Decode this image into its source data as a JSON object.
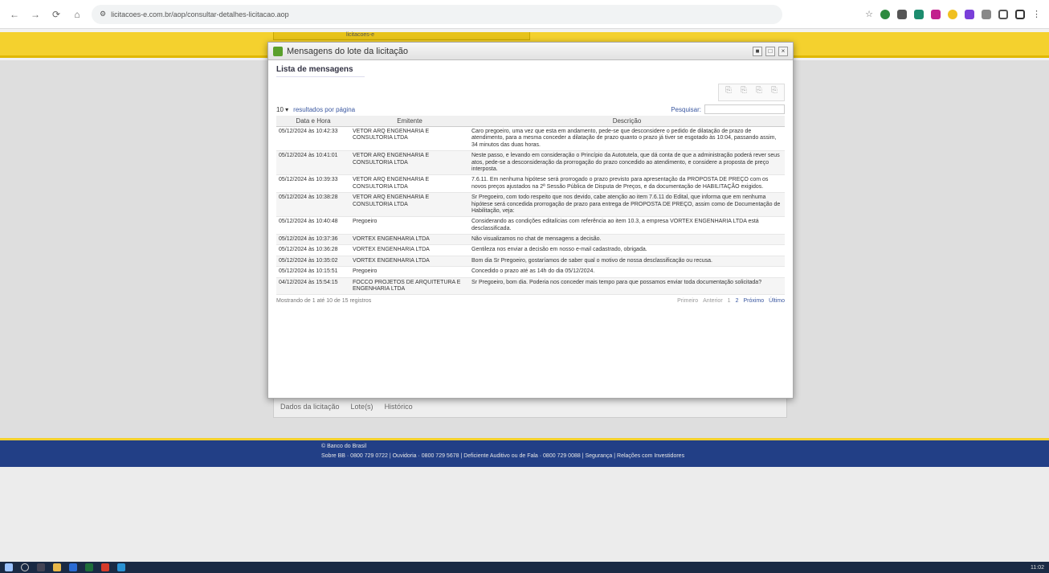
{
  "browser": {
    "url": "licitacoes-e.com.br/aop/consultar-detalhes-licitacao.aop",
    "back": "←",
    "forward": "→",
    "reload": "⟳",
    "home": "⌂"
  },
  "site": {
    "top_tab": "licitacoes-e",
    "behind_tabs": [
      "Dados da licitação",
      "Lote(s)",
      "Histórico"
    ]
  },
  "modal": {
    "title": "Mensagens do lote da licitação",
    "controls": [
      "■",
      "□",
      "×"
    ],
    "section_title": "Lista de mensagens",
    "page_size": "10",
    "page_size_label": "resultados por página",
    "search_label": "Pesquisar:",
    "columns": [
      "Data e Hora",
      "Emitente",
      "Descrição"
    ],
    "rows": [
      {
        "date": "05/12/2024 às 10:42:33",
        "sender": "VETOR ARQ ENGENHARIA E CONSULTORIA LTDA",
        "desc": "Caro pregoeiro, uma vez que esta em andamento, pede-se que desconsidere o pedido de dilatação de prazo de atendimento, para a mesma conceder a dilatação de prazo quanto o prazo já tiver se esgotado às 10:04, passando assim, 34 minutos das duas horas."
      },
      {
        "date": "05/12/2024 às 10:41:01",
        "sender": "VETOR ARQ ENGENHARIA E CONSULTORIA LTDA",
        "desc": "Neste passo, e levando em consideração o Princípio da Autotutela, que dá conta de que a administração poderá rever seus atos, pede-se a desconsideração da prorrogação do prazo concedido ao atendimento, e considere a proposta de preço interposta."
      },
      {
        "date": "05/12/2024 às 10:39:33",
        "sender": "VETOR ARQ ENGENHARIA E CONSULTORIA LTDA",
        "desc": "7.6.11. Em nenhuma hipótese será prorrogado o prazo previsto para apresentação da PROPOSTA DE PREÇO com os novos preços ajustados na 2ª Sessão Pública de Disputa de Preços, e da documentação de HABILITAÇÃO exigidos."
      },
      {
        "date": "05/12/2024 às 10:38:28",
        "sender": "VETOR ARQ ENGENHARIA E CONSULTORIA LTDA",
        "desc": "Sr Pregoeiro, com todo respeito que nos devido, cabe atenção ao item 7.6.11 do Edital, que informa que em nenhuma hipótese será concedida prorrogação de prazo para entrega de PROPOSTA DE PREÇO, assim como de Documentação de Habilitação, veja:"
      },
      {
        "date": "05/12/2024 às 10:40:48",
        "sender": "Pregoeiro",
        "desc": "Considerando as condições editalícias com referência ao item 10.3, a empresa VORTEX ENGENHARIA LTDA está desclassificada."
      },
      {
        "date": "05/12/2024 às 10:37:36",
        "sender": "VORTEX ENGENHARIA LTDA",
        "desc": "Não visualizamos no chat de mensagens a decisão."
      },
      {
        "date": "05/12/2024 às 10:36:28",
        "sender": "VORTEX ENGENHARIA LTDA",
        "desc": "Gentileza nos enviar a decisão em nosso e-mail cadastrado, obrigada."
      },
      {
        "date": "05/12/2024 às 10:35:02",
        "sender": "VORTEX ENGENHARIA LTDA",
        "desc": "Bom dia Sr Pregoeiro, gostaríamos de saber qual o motivo de nossa desclassificação ou recusa."
      },
      {
        "date": "05/12/2024 às 10:15:51",
        "sender": "Pregoeiro",
        "desc": "Concedido o prazo até as 14h do dia 05/12/2024."
      },
      {
        "date": "04/12/2024 às 15:54:15",
        "sender": "FOCCO PROJETOS DE ARQUITETURA E ENGENHARIA LTDA",
        "desc": "Sr Pregoeiro, bom dia. Poderia nos conceder mais tempo para que possamos enviar toda documentação solicitada?"
      }
    ],
    "summary": "Mostrando de 1 até 10 de 15 registros",
    "pager": [
      "Primeiro",
      "Anterior",
      "1",
      "2",
      "Próximo",
      "Último"
    ]
  },
  "footer": {
    "line1": "© Banco do Brasil",
    "line2": "Sobre BB · 0800 729 0722   |   Ouvidoria · 0800 729 5678   |   Deficiente Auditivo ou de Fala · 0800 729 0088   |   Segurança   |   Relações com Investidores"
  },
  "taskbar": {
    "clock": "11:02"
  },
  "colors": {
    "yellow": "#f4d12e",
    "blue": "#223f86"
  }
}
